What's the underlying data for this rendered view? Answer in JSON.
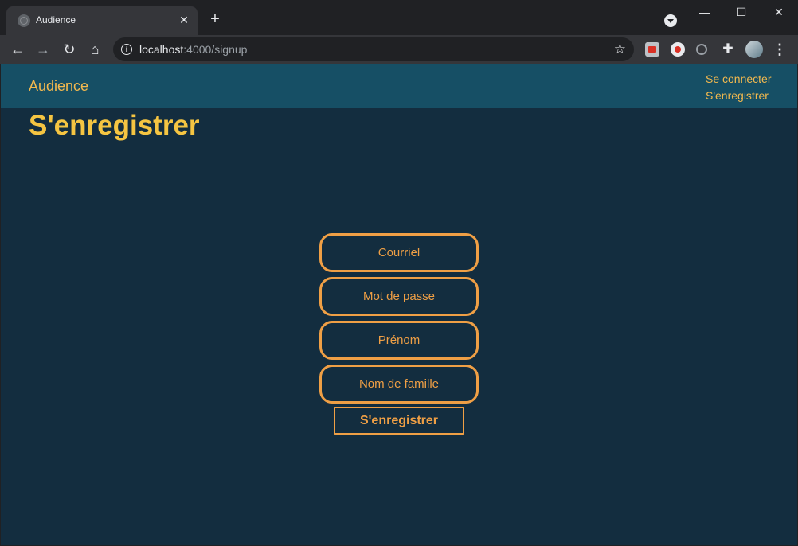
{
  "browser": {
    "tab_title": "Audience",
    "tab_favicon": "globe-icon",
    "url_host": "localhost",
    "url_path": ":4000/signup",
    "extensions": [
      "cast-icon",
      "record-icon",
      "circle-icon",
      "puzzle-icon"
    ]
  },
  "header": {
    "brand": "Audience",
    "links": [
      "Se connecter",
      "S'enregistrer"
    ]
  },
  "page": {
    "title": "S'enregistrer"
  },
  "form": {
    "email_placeholder": "Courriel",
    "password_placeholder": "Mot de passe",
    "firstname_placeholder": "Prénom",
    "lastname_placeholder": "Nom de famille",
    "submit_label": "S'enregistrer"
  },
  "colors": {
    "header_bg": "#164f65",
    "page_bg": "#132d3f",
    "accent_orange": "#ef9f45",
    "title_yellow": "#f5c542"
  }
}
